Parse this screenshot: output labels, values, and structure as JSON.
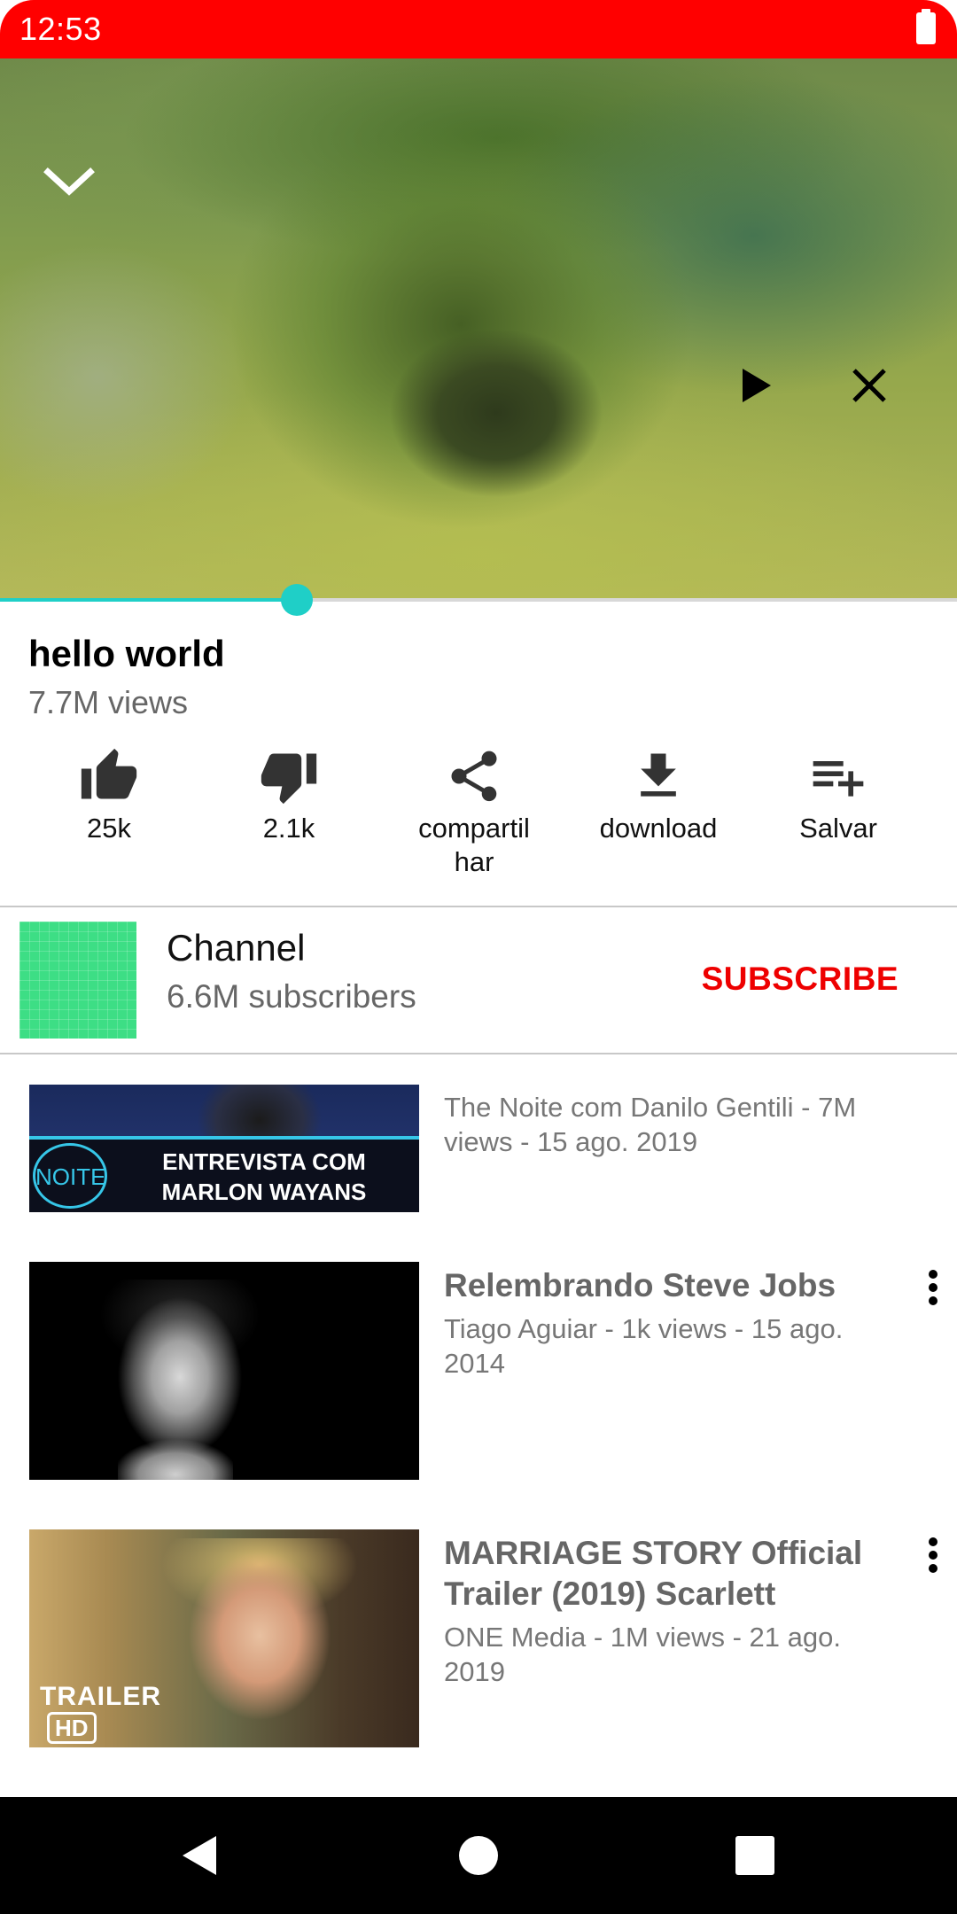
{
  "status_bar": {
    "time": "12:53",
    "icons": [
      "battery-icon"
    ],
    "color": "#ff0000"
  },
  "player": {
    "icons": [
      "chevron-down-icon",
      "play-icon",
      "close-icon"
    ],
    "progress_fraction": 0.31,
    "accent_color": "#1fcfc7"
  },
  "video": {
    "title": "hello world",
    "views": "7.7M views"
  },
  "actions": [
    {
      "icon": "thumb-up-icon",
      "label": "25k"
    },
    {
      "icon": "thumb-down-icon",
      "label": "2.1k"
    },
    {
      "icon": "share-icon",
      "label": "compartil\nhar"
    },
    {
      "icon": "download-icon",
      "label": "download"
    },
    {
      "icon": "playlist-add-icon",
      "label": "Salvar"
    }
  ],
  "channel": {
    "name": "Channel",
    "subscribers": "6.6M subscribers",
    "subscribe_label": "SUBSCRIBE",
    "subscribe_color": "#ee0000"
  },
  "recommendations": [
    {
      "title": "",
      "meta": "The Noite com Danilo Gentili - 7M views - 15 ago. 2019",
      "thumb_text": {
        "logo": "NOITE",
        "line1": "ENTREVISTA COM",
        "line2": "MARLON WAYANS"
      }
    },
    {
      "title": "Relembrando Steve Jobs",
      "meta": "Tiago Aguiar - 1k views - 15 ago. 2014"
    },
    {
      "title": "MARRIAGE STORY Official Trailer (2019) Scarlett",
      "meta": "ONE Media - 1M views - 21 ago. 2019",
      "thumb_text": {
        "badge1": "TRAILER",
        "badge2": "HD"
      }
    }
  ],
  "nav_bar": {
    "icons": [
      "back-icon",
      "home-icon",
      "recents-icon"
    ]
  }
}
